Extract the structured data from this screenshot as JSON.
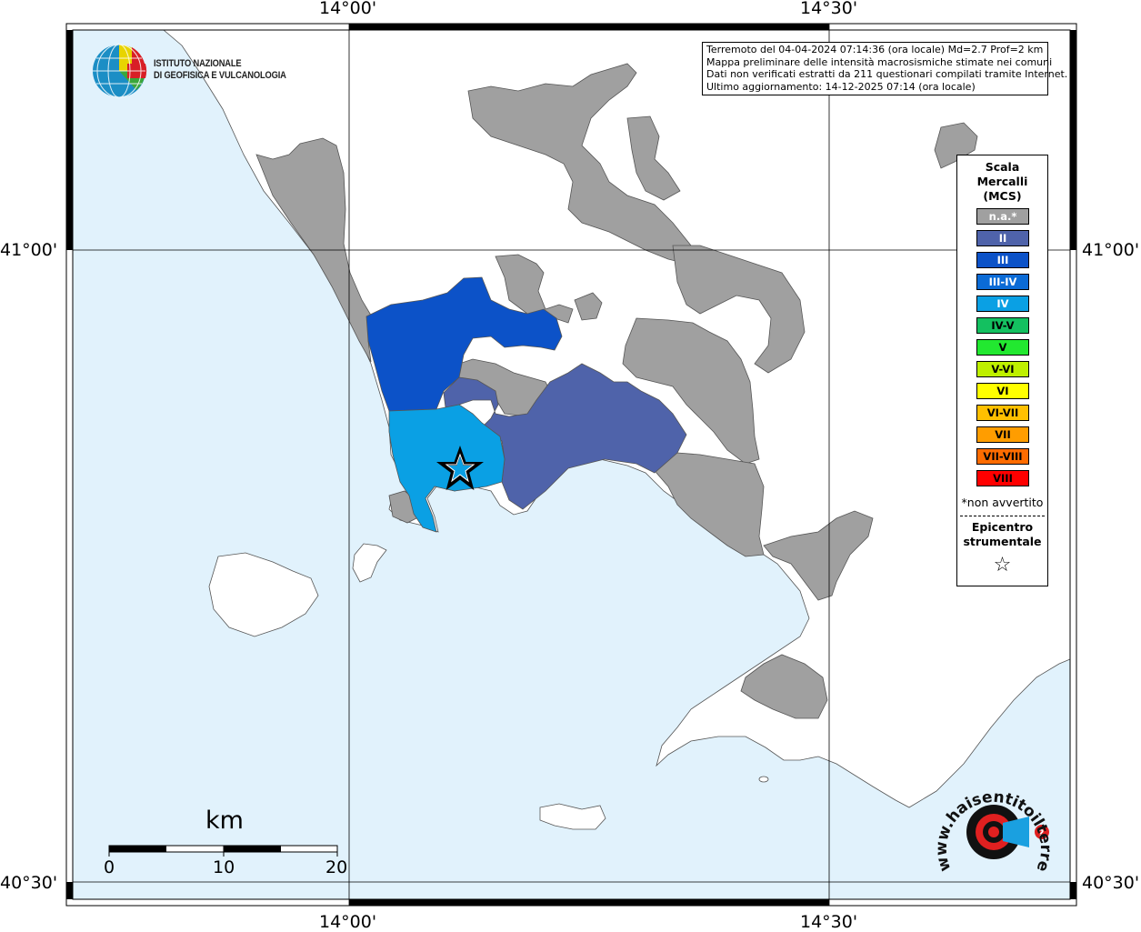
{
  "header": {
    "logo_line1": "ISTITUTO NAZIONALE",
    "logo_line2": "DI GEOFISICA E VULCANOLOGIA"
  },
  "info_box": {
    "line1": "Terremoto del 04-04-2024 07:14:36 (ora locale) Md=2.7 Prof=2 km",
    "line2": "Mappa preliminare delle intensità macrosismiche stimate nei comuni",
    "line3": "Dati non verificati estratti da 211 questionari compilati tramite Internet.",
    "line4": "Ultimo aggiornamento: 14-12-2025 07:14 (ora locale)"
  },
  "axes": {
    "lon_left": "14°00'",
    "lon_right": "14°30'",
    "lat_top": "41°00'",
    "lat_bottom": "40°30'"
  },
  "legend": {
    "title": "Scala\nMercalli\n(MCS)",
    "items": [
      {
        "label": "n.a.*",
        "color": "#a0a0a0",
        "text_color": "#ffffff"
      },
      {
        "label": "II",
        "color": "#4f63aa",
        "text_color": "#ffffff"
      },
      {
        "label": "III",
        "color": "#0c52c8",
        "text_color": "#ffffff"
      },
      {
        "label": "III-IV",
        "color": "#0b6bd6",
        "text_color": "#ffffff"
      },
      {
        "label": "IV",
        "color": "#0aa0e4",
        "text_color": "#ffffff"
      },
      {
        "label": "IV-V",
        "color": "#14c060",
        "text_color": "#000000"
      },
      {
        "label": "V",
        "color": "#22e830",
        "text_color": "#000000"
      },
      {
        "label": "V-VI",
        "color": "#bef000",
        "text_color": "#000000"
      },
      {
        "label": "VI",
        "color": "#ffff00",
        "text_color": "#000000"
      },
      {
        "label": "VI-VII",
        "color": "#ffc000",
        "text_color": "#000000"
      },
      {
        "label": "VII",
        "color": "#ff9d00",
        "text_color": "#000000"
      },
      {
        "label": "VII-VIII",
        "color": "#ff6c00",
        "text_color": "#000000"
      },
      {
        "label": "VIII",
        "color": "#ff0000",
        "text_color": "#000000"
      }
    ],
    "note": "*non avvertito",
    "epicenter_label": "Epicentro\nstrumentale",
    "epicenter_symbol": "☆"
  },
  "scale_bar": {
    "unit": "km",
    "labels": [
      "0",
      "10",
      "20"
    ]
  },
  "colors": {
    "sea": "#e1f2fc",
    "land": "#ffffff",
    "na": "#a0a0a0",
    "II": "#4f63aa",
    "III": "#0c52c8",
    "IV": "#0aa0e4"
  },
  "watermark": {
    "text": "www.haisentitoilterremoto.it"
  }
}
